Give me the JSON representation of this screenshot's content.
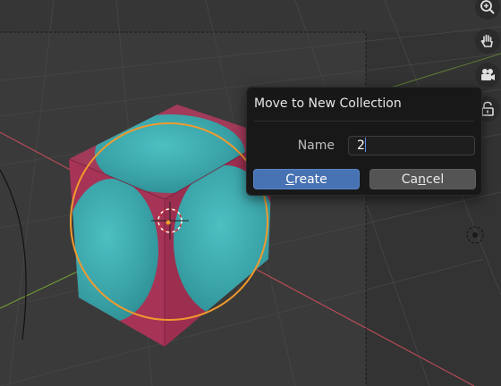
{
  "dialog": {
    "title": "Move to New Collection",
    "name_label": "Name",
    "name_value": "2",
    "create_prefix": "",
    "create_mnemonic": "C",
    "create_rest": "reate",
    "cancel_prefix": "Ca",
    "cancel_mnemonic": "n",
    "cancel_rest": "cel"
  },
  "nav_gizmo": {
    "icons": [
      "zoom-icon",
      "hand-pan-icon",
      "camera-icon",
      "lock-icon"
    ]
  },
  "colors": {
    "viewport_bg": "#3a3a3a",
    "grid_line": "#434343",
    "x_axis": "#b84b57",
    "y_axis": "#6f9a34",
    "selection_outline": "#f09a2e",
    "cube_face": "#a73456",
    "sphere": "#3aa3a8",
    "button_blue": "#4772b3"
  }
}
